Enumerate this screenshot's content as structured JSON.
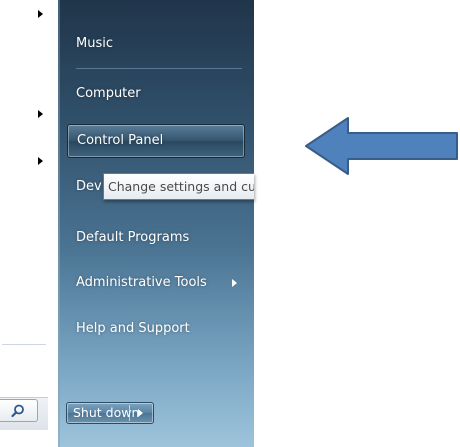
{
  "menu": {
    "items": [
      {
        "label": "Music"
      },
      {
        "label": "Computer"
      },
      {
        "label": "Control Panel"
      },
      {
        "label": "Devices and Printers"
      },
      {
        "label": "Default Programs"
      },
      {
        "label": "Administrative Tools"
      },
      {
        "label": "Help and Support"
      }
    ],
    "shutdown_label": "Shut down"
  },
  "tooltip": {
    "text": "Change settings and customize the functionality of this computer."
  },
  "icons": {
    "search": "search-icon",
    "submenu": "chevron-right-icon",
    "shutdown_options": "chevron-right-icon",
    "pointer": "arrow-left-icon"
  },
  "colors": {
    "menu_top": "#20354a",
    "menu_bottom": "#9ec4dc",
    "pointer_fill": "#4f81bd",
    "pointer_stroke": "#385d8a"
  }
}
